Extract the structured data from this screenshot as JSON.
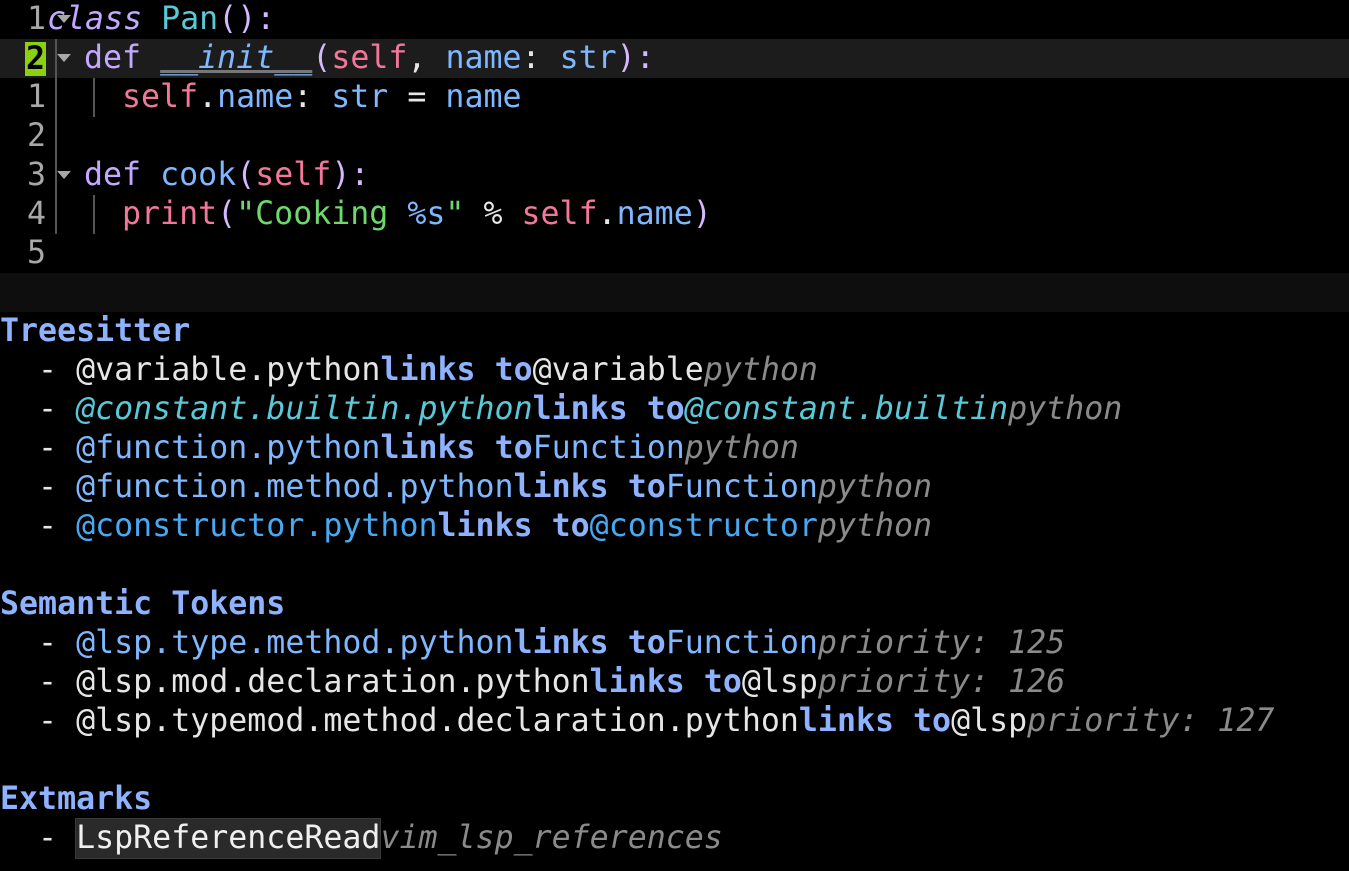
{
  "editor": {
    "lines": [
      {
        "nr": "1",
        "fold": true,
        "current": false
      },
      {
        "nr": "2",
        "fold": true,
        "current": true
      },
      {
        "nr": "1",
        "fold": false,
        "current": false
      },
      {
        "nr": "2",
        "fold": false,
        "current": false
      },
      {
        "nr": "3",
        "fold": true,
        "current": false
      },
      {
        "nr": "4",
        "fold": false,
        "current": false
      },
      {
        "nr": "5",
        "fold": false,
        "current": false
      }
    ],
    "code": {
      "l1": {
        "kw": "class",
        "name": "Pan",
        "rest": "():"
      },
      "l2": {
        "kw": "def",
        "name": "__init__",
        "p1": "(",
        "self": "self",
        "c1": ", ",
        "param": "name",
        "c2": ": ",
        "type": "str",
        "end": "):"
      },
      "l3": {
        "self": "self",
        "dot": ".",
        "attr": "name",
        "c1": ": ",
        "type": "str",
        "eq": " = ",
        "val": "name"
      },
      "l5": {
        "kw": "def",
        "name": "cook",
        "p1": "(",
        "self": "self",
        "end": "):"
      },
      "l6": {
        "fn": "print",
        "p1": "(",
        "str": "\"Cooking ",
        "fmt": "%s",
        "strend": "\"",
        "op": " % ",
        "self": "self",
        "dot": ".",
        "attr": "name",
        "end": ")"
      }
    }
  },
  "inspect": {
    "treesitter": {
      "title": "Treesitter",
      "items": [
        {
          "dash": "- ",
          "capture": "@variable.python",
          "links": "links to",
          "target": "@variable",
          "lang": "python"
        },
        {
          "dash": "- ",
          "capture": "@constant.builtin.python",
          "links": "links to",
          "target": "@constant.builtin",
          "lang": "python"
        },
        {
          "dash": "- ",
          "capture": "@function.python",
          "links": "links to",
          "target": "Function",
          "lang": "python"
        },
        {
          "dash": "- ",
          "capture": "@function.method.python",
          "links": "links to",
          "target": "Function",
          "lang": "python"
        },
        {
          "dash": "- ",
          "capture": "@constructor.python",
          "links": "links to",
          "target": "@constructor",
          "lang": "python"
        }
      ]
    },
    "semantic": {
      "title": "Semantic Tokens",
      "items": [
        {
          "dash": "- ",
          "capture": "@lsp.type.method.python",
          "links": "links to",
          "target": "Function",
          "priority": "priority: 125"
        },
        {
          "dash": "- ",
          "capture": "@lsp.mod.declaration.python",
          "links": "links to",
          "target": "@lsp",
          "priority": "priority: 126"
        },
        {
          "dash": "- ",
          "capture": "@lsp.typemod.method.declaration.python",
          "links": "links to",
          "target": "@lsp",
          "priority": "priority: 127"
        }
      ]
    },
    "extmarks": {
      "title": "Extmarks",
      "items": [
        {
          "dash": "- ",
          "group": "LspReferenceRead",
          "ns": "vim_lsp_references"
        }
      ]
    }
  }
}
